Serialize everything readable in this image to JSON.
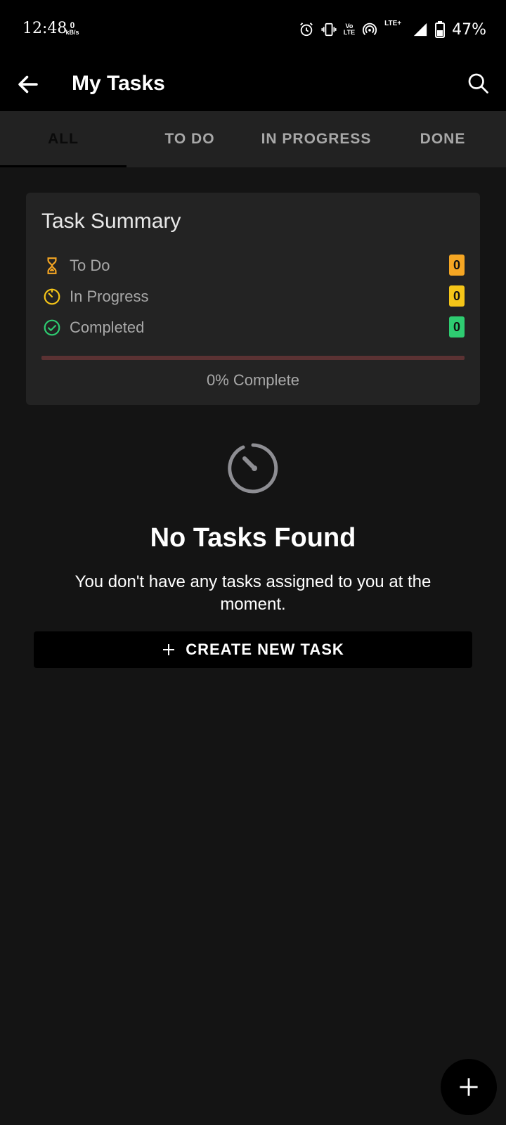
{
  "status_bar": {
    "time": "12:48",
    "net_speed_value": "0",
    "net_speed_unit": "kB/s",
    "volte_top": "Vo",
    "volte_bottom": "LTE",
    "lte_label": "LTE+",
    "battery_percent": "47%",
    "icons": [
      "alarm-icon",
      "vibrate-icon",
      "volte-icon",
      "hotspot-icon",
      "signal-icon",
      "battery-icon"
    ]
  },
  "app_bar": {
    "title": "My Tasks",
    "back_icon": "arrow-left-icon",
    "search_icon": "search-icon"
  },
  "tabs": [
    {
      "label": "ALL",
      "active": true
    },
    {
      "label": "TO DO",
      "active": false
    },
    {
      "label": "IN PROGRESS",
      "active": false
    },
    {
      "label": "DONE",
      "active": false
    }
  ],
  "summary": {
    "title": "Task Summary",
    "rows": [
      {
        "label": "To Do",
        "count": "0",
        "icon": "hourglass-icon",
        "color": "#f5a623"
      },
      {
        "label": "In Progress",
        "count": "0",
        "icon": "timer-icon",
        "color": "#f5c518"
      },
      {
        "label": "Completed",
        "count": "0",
        "icon": "check-circle-icon",
        "color": "#2ecc71"
      }
    ],
    "progress_fraction": 0,
    "progress_label": "0% Complete"
  },
  "empty_state": {
    "icon": "timer-icon",
    "title": "No Tasks Found",
    "message": "You don't have any tasks assigned to you at the moment.",
    "button_label": "CREATE NEW TASK"
  },
  "fab": {
    "icon": "plus-icon"
  }
}
